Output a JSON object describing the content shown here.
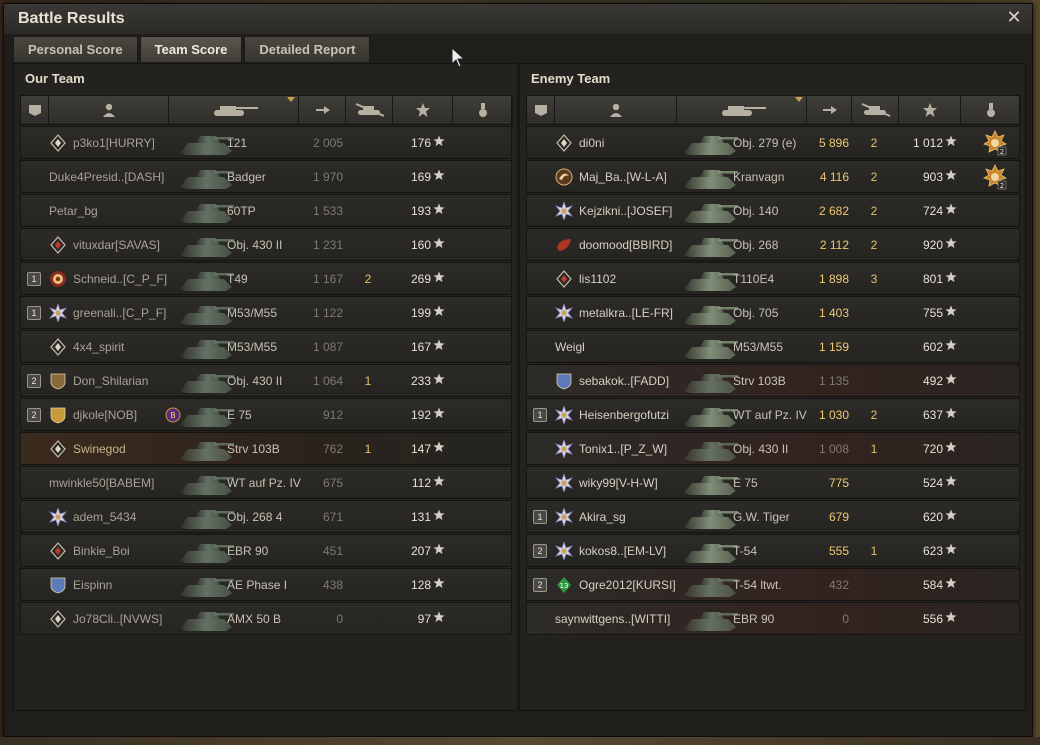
{
  "window": {
    "title": "Battle Results"
  },
  "tabs": [
    {
      "label": "Personal Score",
      "active": false
    },
    {
      "label": "Team Score",
      "active": true
    },
    {
      "label": "Detailed Report",
      "active": false
    }
  ],
  "columns": {
    "icons": [
      "platoon-icon",
      "player-icon",
      "tank-icon",
      "damage-icon",
      "kills-icon",
      "xp-star-icon",
      "medal-icon"
    ],
    "sorted_by": "tank"
  },
  "our_team": {
    "title": "Our Team",
    "rows": [
      {
        "platoon": "",
        "name": "p3ko1[HURRY]",
        "tank": "121",
        "damage": "2 005",
        "kills": "",
        "xp": "176",
        "emblem": "diamond",
        "dim": true
      },
      {
        "platoon": "",
        "name": "Duke4Presid..[DASH]",
        "tank": "Badger",
        "damage": "1 970",
        "kills": "",
        "xp": "169",
        "emblem": "",
        "dim": true
      },
      {
        "platoon": "",
        "name": "Petar_bg",
        "tank": "60TP",
        "damage": "1 533",
        "kills": "",
        "xp": "193",
        "emblem": "",
        "dim": true
      },
      {
        "platoon": "",
        "name": "vituxdar[SAVAS]",
        "tank": "Obj. 430 II",
        "damage": "1 231",
        "kills": "",
        "xp": "160",
        "emblem": "diamond-red",
        "dim": true
      },
      {
        "platoon": "1",
        "name": "Schneid..[C_P_F]",
        "tank": "T49",
        "damage": "1 167",
        "kills": "2",
        "xp": "269",
        "emblem": "target",
        "dim": true
      },
      {
        "platoon": "1",
        "name": "greenali..[C_P_F]",
        "tank": "M53/M55",
        "damage": "1 122",
        "kills": "",
        "xp": "199",
        "emblem": "star",
        "dim": true
      },
      {
        "platoon": "",
        "name": "4x4_spirit",
        "tank": "M53/M55",
        "damage": "1 087",
        "kills": "",
        "xp": "167",
        "emblem": "diamond",
        "dim": true
      },
      {
        "platoon": "2",
        "name": "Don_Shilarian",
        "tank": "Obj. 430 II",
        "damage": "1 064",
        "kills": "1",
        "xp": "233",
        "emblem": "shield",
        "dim": true
      },
      {
        "platoon": "2",
        "name": "djkole[NOB]",
        "tank": "E 75",
        "damage": "912",
        "kills": "",
        "xp": "192",
        "emblem": "shield-gold",
        "dim": true,
        "extra_badge": "B"
      },
      {
        "platoon": "",
        "name": "Swinegod",
        "tank": "Strv 103B",
        "damage": "762",
        "kills": "1",
        "xp": "147",
        "emblem": "diamond",
        "dim": true,
        "self": true
      },
      {
        "platoon": "",
        "name": "mwinkle50[BABEM]",
        "tank": "WT auf Pz. IV",
        "damage": "675",
        "kills": "",
        "xp": "112",
        "emblem": "",
        "dim": true
      },
      {
        "platoon": "",
        "name": "adem_5434",
        "tank": "Obj. 268 4",
        "damage": "671",
        "kills": "",
        "xp": "131",
        "emblem": "star",
        "dim": true
      },
      {
        "platoon": "",
        "name": "Binkie_Boi",
        "tank": "EBR 90",
        "damage": "451",
        "kills": "",
        "xp": "207",
        "emblem": "diamond-red",
        "dim": true
      },
      {
        "platoon": "",
        "name": "Eispinn",
        "tank": "AE Phase I",
        "damage": "438",
        "kills": "",
        "xp": "128",
        "emblem": "shield-blue",
        "dim": true
      },
      {
        "platoon": "",
        "name": "Jo78Cli..[NVWS]",
        "tank": "AMX 50 B",
        "damage": "0",
        "kills": "",
        "xp": "97",
        "emblem": "diamond",
        "dim": true
      }
    ]
  },
  "enemy_team": {
    "title": "Enemy Team",
    "rows": [
      {
        "platoon": "",
        "name": "di0ni",
        "tank": "Obj. 279 (e)",
        "damage": "5 896",
        "kills": "2",
        "xp": "1 012",
        "emblem": "diamond",
        "medal": "2",
        "dim": false
      },
      {
        "platoon": "",
        "name": "Maj_Ba..[W-L-A]",
        "tank": "Kranvagn",
        "damage": "4 116",
        "kills": "2",
        "xp": "903",
        "emblem": "swirl",
        "medal": "2",
        "dim": false
      },
      {
        "platoon": "",
        "name": "Kejzikni..[JOSEF]",
        "tank": "Obj. 140",
        "damage": "2 682",
        "kills": "2",
        "xp": "724",
        "emblem": "star",
        "dim": false
      },
      {
        "platoon": "",
        "name": "doomood[BBIRD]",
        "tank": "Obj. 268",
        "damage": "2 112",
        "kills": "2",
        "xp": "920",
        "emblem": "leaf-red",
        "dim": false
      },
      {
        "platoon": "",
        "name": "lis1102",
        "tank": "T110E4",
        "damage": "1 898",
        "kills": "3",
        "xp": "801",
        "emblem": "diamond-red",
        "dim": false
      },
      {
        "platoon": "",
        "name": "metalkra..[LE-FR]",
        "tank": "Obj. 705",
        "damage": "1 403",
        "kills": "",
        "xp": "755",
        "emblem": "star",
        "dim": false
      },
      {
        "platoon": "",
        "name": "Weigl",
        "tank": "M53/M55",
        "damage": "1 159",
        "kills": "",
        "xp": "602",
        "emblem": "",
        "dim": false
      },
      {
        "platoon": "",
        "name": "sebakok..[FADD]",
        "tank": "Strv 103B",
        "damage": "1 135",
        "kills": "",
        "xp": "492",
        "emblem": "shield-blue",
        "dim": true
      },
      {
        "platoon": "1",
        "name": "Heisenbergofutzi",
        "tank": "WT auf Pz. IV",
        "damage": "1 030",
        "kills": "2",
        "xp": "637",
        "emblem": "star",
        "dim": false
      },
      {
        "platoon": "",
        "name": "Tonix1..[P_Z_W]",
        "tank": "Obj. 430 II",
        "damage": "1 008",
        "kills": "1",
        "xp": "720",
        "emblem": "star",
        "dim": true
      },
      {
        "platoon": "",
        "name": "wiky99[V-H-W]",
        "tank": "E 75",
        "damage": "775",
        "kills": "",
        "xp": "524",
        "emblem": "star",
        "dim": false
      },
      {
        "platoon": "1",
        "name": "Akira_sg",
        "tank": "G.W. Tiger",
        "damage": "679",
        "kills": "",
        "xp": "620",
        "emblem": "star",
        "dim": false
      },
      {
        "platoon": "2",
        "name": "kokos8..[EM-LV]",
        "tank": "T-54",
        "damage": "555",
        "kills": "1",
        "xp": "623",
        "emblem": "star",
        "dim": false
      },
      {
        "platoon": "2",
        "name": "Ogre2012[KURSI]",
        "tank": "T-54 ltwt.",
        "damage": "432",
        "kills": "",
        "xp": "584",
        "emblem": "green-13",
        "dim": true,
        "emblem_text": "13"
      },
      {
        "platoon": "",
        "name": "saynwittgens..[WITTI]",
        "tank": "EBR 90",
        "damage": "0",
        "kills": "",
        "xp": "556",
        "emblem": "",
        "dim": true
      }
    ]
  }
}
